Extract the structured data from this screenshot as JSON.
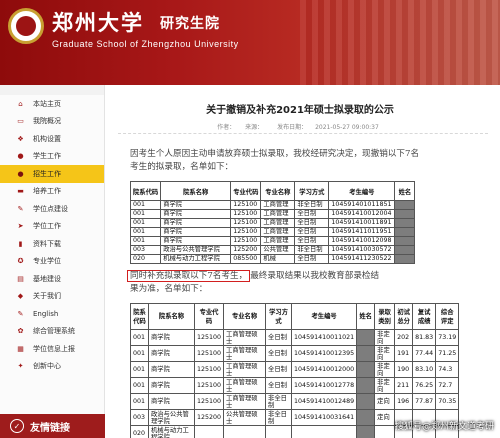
{
  "header": {
    "school_cn": "郑州大学",
    "school_suffix": "研究生院",
    "school_en": "Graduate School of Zhengzhou University"
  },
  "sidebar": {
    "items": [
      {
        "label": "本站主页",
        "icon": "home-icon"
      },
      {
        "label": "我院概况",
        "icon": "info-icon"
      },
      {
        "label": "机构设置",
        "icon": "org-icon"
      },
      {
        "label": "学生工作",
        "icon": "student-icon"
      },
      {
        "label": "招生工作",
        "icon": "admission-icon",
        "active": true
      },
      {
        "label": "培养工作",
        "icon": "training-icon"
      },
      {
        "label": "学位点建设",
        "icon": "build-icon"
      },
      {
        "label": "学位工作",
        "icon": "degree-icon"
      },
      {
        "label": "资料下载",
        "icon": "download-icon"
      },
      {
        "label": "专业学位",
        "icon": "professional-icon"
      },
      {
        "label": "基地建设",
        "icon": "base-icon"
      },
      {
        "label": "关于我们",
        "icon": "about-icon"
      },
      {
        "label": "English",
        "icon": "english-icon"
      },
      {
        "label": "综合管理系统",
        "icon": "system-icon"
      },
      {
        "label": "学位信息上报",
        "icon": "report-icon"
      },
      {
        "label": "创新中心",
        "icon": "innovation-icon"
      }
    ],
    "friend_links": "友情链接"
  },
  "article": {
    "title": "关于撤销及补充2021年硕士拟录取的公示",
    "author_label": "作者：",
    "source_label": "来源：",
    "date_label": "发布日期：",
    "date": "2021-05-27 09:00:37",
    "p1_line1": "因考生个人原因主动申请放弃硕士拟录取，我校经研究决定，现撤销以下7名",
    "p1_line2": "考生的拟录取，名单如下：",
    "p2_highlight": "同时补充拟录取以下7名考生，",
    "p2_rest": "最终录取结果以我校教育部录检结",
    "p2_line2": "果为准，名单如下："
  },
  "table1": {
    "headers": [
      "院系代码",
      "院系名称",
      "专业代码",
      "专业名称",
      "学习方式",
      "考生编号",
      "姓名"
    ],
    "rows": [
      [
        "001",
        "商学院",
        "125100",
        "工商管理",
        "非全日制",
        "104591401011851"
      ],
      [
        "001",
        "商学院",
        "125100",
        "工商管理",
        "全日制",
        "104591410012004"
      ],
      [
        "001",
        "商学院",
        "125100",
        "工商管理",
        "全日制",
        "104591410011891"
      ],
      [
        "001",
        "商学院",
        "125100",
        "工商管理",
        "全日制",
        "104591411011951"
      ],
      [
        "001",
        "商学院",
        "125100",
        "工商管理",
        "全日制",
        "104591410012098"
      ],
      [
        "003",
        "政治与公共管理学院",
        "125200",
        "公共管理",
        "非全日制",
        "104591410030572"
      ],
      [
        "020",
        "机械与动力工程学院",
        "085500",
        "机械",
        "全日制",
        "104591411230522"
      ]
    ]
  },
  "table2": {
    "headers": [
      "院系代码",
      "院系名称",
      "专业代码",
      "专业名称",
      "学习方式",
      "考生编号",
      "姓名",
      "录取类别",
      "初试总分",
      "复试成绩",
      "综合评定"
    ],
    "rows": [
      [
        "001",
        "商学院",
        "125100",
        "工商管理硕士",
        "全日制",
        "104591410011021",
        "",
        "非定向",
        "202",
        "81.83",
        "73.19"
      ],
      [
        "001",
        "商学院",
        "125100",
        "工商管理硕士",
        "全日制",
        "104591410012395",
        "",
        "非定向",
        "191",
        "77.44",
        "71.25"
      ],
      [
        "001",
        "商学院",
        "125100",
        "工商管理硕士",
        "全日制",
        "104591410012000",
        "",
        "非定向",
        "190",
        "83.10",
        "74.3"
      ],
      [
        "001",
        "商学院",
        "125100",
        "工商管理硕士",
        "全日制",
        "104591410012778",
        "",
        "非定向",
        "211",
        "76.25",
        "72.7"
      ],
      [
        "001",
        "商学院",
        "125100",
        "工商管理硕士",
        "非全日制",
        "104591410012489",
        "",
        "定向",
        "196",
        "77.87",
        "70.35"
      ],
      [
        "003",
        "政治与公共管理学院",
        "125200",
        "公共管理硕士",
        "非全日制",
        "104591410031641",
        "",
        "定向",
        "",
        "",
        ""
      ],
      [
        "020",
        "机械与动力工程学院",
        "",
        "",
        "",
        "",
        "",
        "",
        "",
        "",
        ""
      ]
    ]
  },
  "watermark": "搜狐号@郑州新文道考研"
}
